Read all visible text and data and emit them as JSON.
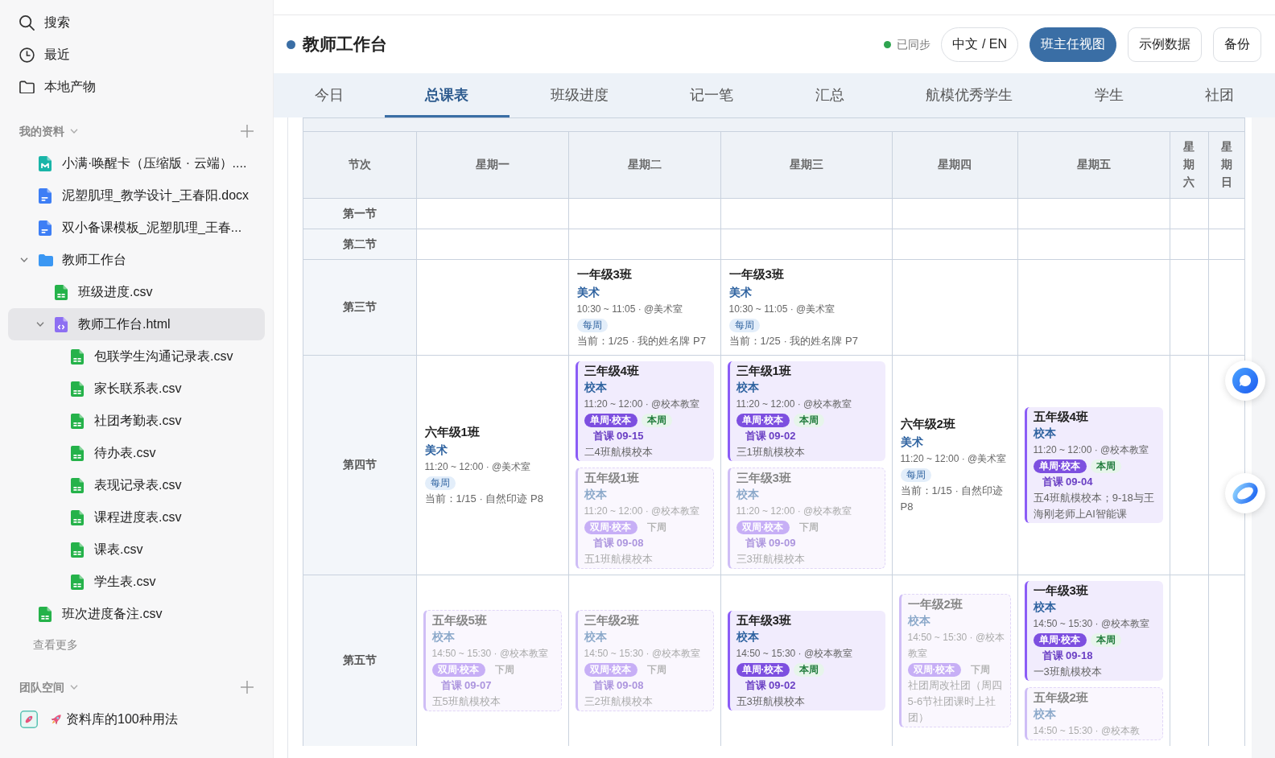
{
  "sidebar": {
    "nav": [
      {
        "kind": "search",
        "label": "搜索"
      },
      {
        "kind": "recent",
        "label": "最近"
      },
      {
        "kind": "artifacts",
        "label": "本地产物"
      }
    ],
    "sections": [
      {
        "title": "我的资料",
        "items": [
          {
            "kind": "markdown",
            "label": "小满·唤醒卡（压缩版 · 云端）....",
            "selected": false
          },
          {
            "kind": "doc",
            "label": "泥塑肌理_教学设计_王春阳.docx",
            "selected": false
          },
          {
            "kind": "doc",
            "label": "双小备课模板_泥塑肌理_王春...",
            "selected": false
          },
          {
            "kind": "folder",
            "label": "教师工作台",
            "selected": false,
            "expanded": true,
            "children": [
              {
                "kind": "sheet",
                "label": "班级进度.csv",
                "selected": false
              },
              {
                "kind": "html",
                "label": "教师工作台.html",
                "selected": true,
                "expanded": true,
                "children": [
                  {
                    "kind": "sheet",
                    "label": "包联学生沟通记录表.csv",
                    "selected": false
                  },
                  {
                    "kind": "sheet",
                    "label": "家长联系表.csv",
                    "selected": false
                  },
                  {
                    "kind": "sheet",
                    "label": "社团考勤表.csv",
                    "selected": false
                  },
                  {
                    "kind": "sheet",
                    "label": "待办表.csv",
                    "selected": false
                  },
                  {
                    "kind": "sheet",
                    "label": "表现记录表.csv",
                    "selected": false
                  },
                  {
                    "kind": "sheet",
                    "label": "课程进度表.csv",
                    "selected": false
                  },
                  {
                    "kind": "sheet",
                    "label": "课表.csv",
                    "selected": false
                  },
                  {
                    "kind": "sheet",
                    "label": "学生表.csv",
                    "selected": false
                  }
                ]
              }
            ]
          },
          {
            "kind": "sheet",
            "label": "班次进度备注.csv",
            "selected": false
          }
        ],
        "more": "查看更多"
      },
      {
        "title": "团队空间",
        "items": [
          {
            "kind": "guide",
            "label": "资料库的100种用法",
            "selected": false
          }
        ]
      }
    ]
  },
  "header": {
    "title": "教师工作台",
    "sync": "已同步",
    "buttons": [
      {
        "kind": "toggle",
        "label": "中文 / EN",
        "selected": false
      },
      {
        "kind": "toggle",
        "label": "班主任视图",
        "selected": true
      },
      {
        "kind": "action",
        "label": "示例数据",
        "selected": false
      },
      {
        "kind": "action",
        "label": "备份",
        "selected": false
      }
    ]
  },
  "tabs": [
    {
      "label": "今日",
      "selected": false
    },
    {
      "label": "总课表",
      "selected": true
    },
    {
      "label": "班级进度",
      "selected": false
    },
    {
      "label": "记一笔",
      "selected": false
    },
    {
      "label": "汇总",
      "selected": false
    },
    {
      "label": "航模优秀学生",
      "selected": false
    },
    {
      "label": "学生",
      "selected": false
    },
    {
      "label": "社团",
      "selected": false
    }
  ],
  "timetable": {
    "corner": "节次",
    "columns": [
      "星期一",
      "星期二",
      "星期三",
      "星期四",
      "星期五",
      "星期六",
      "星期日"
    ],
    "rows": [
      {
        "label": "第一节",
        "cells": [
          null,
          null,
          null,
          null,
          null,
          null,
          null
        ]
      },
      {
        "label": "第二节",
        "cells": [
          null,
          null,
          null,
          null,
          null,
          null,
          null
        ]
      },
      {
        "label": "第三节",
        "cells": [
          null,
          {
            "lessons": [
              {
                "kind": "plain",
                "class": "一年级3班",
                "subject": "美术",
                "time": "10:30 ~ 11:05 · @美术室",
                "tags": [
                  {
                    "kind": "weekly",
                    "label": "每周"
                  }
                ],
                "note": "当前：1/25 · 我的姓名牌 P7"
              }
            ]
          },
          {
            "lessons": [
              {
                "kind": "plain",
                "class": "一年级3班",
                "subject": "美术",
                "time": "10:30 ~ 11:05 · @美术室",
                "tags": [
                  {
                    "kind": "weekly",
                    "label": "每周"
                  }
                ],
                "note": "当前：1/25 · 我的姓名牌 P7"
              }
            ]
          },
          null,
          null,
          null,
          null
        ]
      },
      {
        "label": "第四节",
        "cells": [
          {
            "lessons": [
              {
                "kind": "plain",
                "class": "六年级1班",
                "subject": "美术",
                "time": "11:20 ~ 12:00 · @美术室",
                "tags": [
                  {
                    "kind": "weekly",
                    "label": "每周"
                  }
                ],
                "note": "当前：1/15 · 自然印迹 P8"
              }
            ]
          },
          {
            "lessons": [
              {
                "kind": "card",
                "dimmed": false,
                "class": "三年级4班",
                "subject": "校本",
                "time": "11:20 ~ 12:00 · @校本教室",
                "tags": [
                  {
                    "kind": "single",
                    "label": "单周·校本"
                  },
                  {
                    "kind": "this-week",
                    "label": "本周"
                  }
                ],
                "first": "首课 09-15",
                "note": "二4班航模校本"
              },
              {
                "kind": "card",
                "dimmed": true,
                "class": "五年级1班",
                "subject": "校本",
                "time": "11:20 ~ 12:00 · @校本教室",
                "tags": [
                  {
                    "kind": "double",
                    "label": "双周·校本"
                  },
                  {
                    "kind": "next-week",
                    "label": "下周"
                  }
                ],
                "first": "首课 09-08",
                "note": "五1班航模校本"
              }
            ]
          },
          {
            "lessons": [
              {
                "kind": "card",
                "dimmed": false,
                "class": "三年级1班",
                "subject": "校本",
                "time": "11:20 ~ 12:00 · @校本教室",
                "tags": [
                  {
                    "kind": "single",
                    "label": "单周·校本"
                  },
                  {
                    "kind": "this-week",
                    "label": "本周"
                  }
                ],
                "first": "首课 09-02",
                "note": "三1班航模校本"
              },
              {
                "kind": "card",
                "dimmed": true,
                "class": "三年级3班",
                "subject": "校本",
                "time": "11:20 ~ 12:00 · @校本教室",
                "tags": [
                  {
                    "kind": "double",
                    "label": "双周·校本"
                  },
                  {
                    "kind": "next-week",
                    "label": "下周"
                  }
                ],
                "first": "首课 09-09",
                "note": "三3班航模校本"
              }
            ]
          },
          {
            "lessons": [
              {
                "kind": "plain",
                "class": "六年级2班",
                "subject": "美术",
                "time": "11:20 ~ 12:00 · @美术室",
                "tags": [
                  {
                    "kind": "weekly",
                    "label": "每周"
                  }
                ],
                "note": "当前：1/15 · 自然印迹 P8"
              }
            ]
          },
          {
            "lessons": [
              {
                "kind": "card",
                "dimmed": false,
                "class": "五年级4班",
                "subject": "校本",
                "time": "11:20 ~ 12:00 · @校本教室",
                "tags": [
                  {
                    "kind": "single",
                    "label": "单周·校本"
                  },
                  {
                    "kind": "this-week",
                    "label": "本周"
                  }
                ],
                "first": "首课 09-04",
                "note": "五4班航模校本；9-18与王海刚老师上AI智能课"
              }
            ]
          },
          null,
          null
        ]
      },
      {
        "label": "第五节",
        "cells": [
          {
            "lessons": [
              {
                "kind": "card",
                "dimmed": true,
                "class": "五年级5班",
                "subject": "校本",
                "time": "14:50 ~ 15:30 · @校本教室",
                "tags": [
                  {
                    "kind": "double",
                    "label": "双周·校本"
                  },
                  {
                    "kind": "next-week",
                    "label": "下周"
                  }
                ],
                "first": "首课 09-07",
                "note": "五5班航模校本"
              }
            ]
          },
          {
            "lessons": [
              {
                "kind": "card",
                "dimmed": true,
                "class": "三年级2班",
                "subject": "校本",
                "time": "14:50 ~ 15:30 · @校本教室",
                "tags": [
                  {
                    "kind": "double",
                    "label": "双周·校本"
                  },
                  {
                    "kind": "next-week",
                    "label": "下周"
                  }
                ],
                "first": "首课 09-08",
                "note": "三2班航模校本"
              }
            ]
          },
          {
            "lessons": [
              {
                "kind": "card",
                "dimmed": false,
                "class": "五年级3班",
                "subject": "校本",
                "time": "14:50 ~ 15:30 · @校本教室",
                "tags": [
                  {
                    "kind": "single",
                    "label": "单周·校本"
                  },
                  {
                    "kind": "this-week",
                    "label": "本周"
                  }
                ],
                "first": "首课 09-02",
                "note": "五3班航模校本"
              }
            ]
          },
          {
            "lessons": [
              {
                "kind": "card",
                "dimmed": true,
                "class": "一年级2班",
                "subject": "校本",
                "time": "14:50 ~ 15:30 · @校本教室",
                "tags": [
                  {
                    "kind": "double",
                    "label": "双周·校本"
                  },
                  {
                    "kind": "next-week",
                    "label": "下周"
                  }
                ],
                "note": "社团周改社团（周四5-6节社团课时上社团）"
              }
            ]
          },
          {
            "lessons": [
              {
                "kind": "card",
                "dimmed": false,
                "class": "一年级3班",
                "subject": "校本",
                "time": "14:50 ~ 15:30 · @校本教室",
                "tags": [
                  {
                    "kind": "single",
                    "label": "单周·校本"
                  },
                  {
                    "kind": "this-week",
                    "label": "本周"
                  }
                ],
                "first": "首课 09-18",
                "note": "一3班航模校本"
              },
              {
                "kind": "card",
                "dimmed": true,
                "class": "五年级2班",
                "subject": "校本",
                "time": "14:50 ~ 15:30 · @校本教"
              }
            ]
          },
          null,
          null
        ]
      }
    ]
  }
}
